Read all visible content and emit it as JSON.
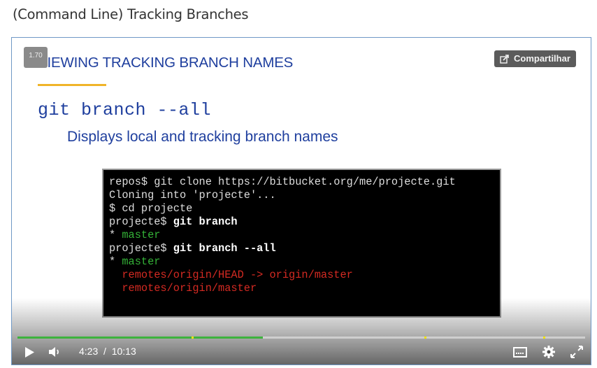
{
  "page": {
    "title": "(Command Line) Tracking Branches"
  },
  "player": {
    "speed": "1.70",
    "share_label": "Compartilhar",
    "slide": {
      "heading": "VIEWING TRACKING BRANCH NAMES",
      "command": "git branch --all",
      "description": "Displays local and tracking branch names"
    },
    "terminal": {
      "lines": [
        {
          "prompt": "repos$ ",
          "cmd": "git clone https://bitbucket.org/me/projecte.git",
          "bold": false
        },
        {
          "text": "Cloning into 'projecte'..."
        },
        {
          "prompt": "$ ",
          "cmd": "cd projecte",
          "bold": false
        },
        {
          "prompt": "projecte$ ",
          "cmd": "git branch",
          "bold": true
        },
        {
          "star": "* ",
          "branch": "master"
        },
        {
          "prompt": "projecte$ ",
          "cmd": "git branch --all",
          "bold": true
        },
        {
          "star": "* ",
          "branch": "master"
        },
        {
          "remote": "  remotes/origin/HEAD -> origin/master"
        },
        {
          "remote": "  remotes/origin/master"
        }
      ]
    },
    "current_time": "4:23",
    "separator": "/",
    "duration": "10:13",
    "progress_fraction": 0.432,
    "marker_fractions": [
      0.307,
      0.717,
      0.926
    ],
    "icons": {
      "play": "play-icon",
      "volume": "volume-icon",
      "captions": "captions-icon",
      "settings": "gear-icon",
      "fullscreen": "fullscreen-icon",
      "share": "share-icon"
    },
    "colors": {
      "slide_text": "#1f3f9e",
      "underline": "#f0b429",
      "progress": "#3db33d",
      "marker": "#f2e300",
      "terminal_green": "#34b237",
      "terminal_red": "#d42a22"
    }
  }
}
